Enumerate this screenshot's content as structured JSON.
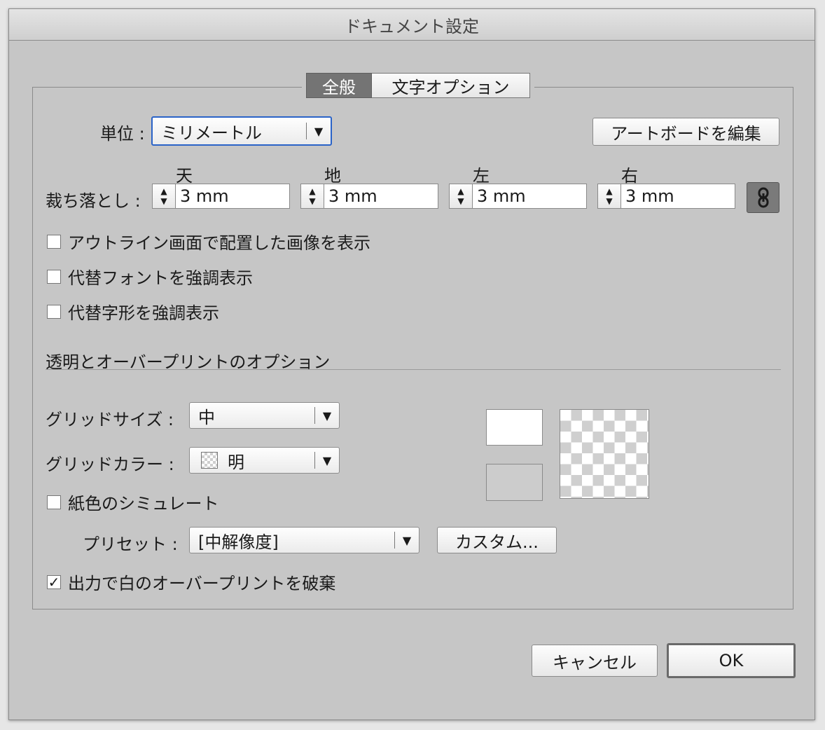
{
  "window": {
    "title": "ドキュメント設定"
  },
  "tabs": [
    {
      "label": "全般",
      "active": true
    },
    {
      "label": "文字オプション",
      "active": false
    }
  ],
  "units": {
    "label": "単位 :",
    "value": "ミリメートル"
  },
  "artboard_button": "アートボードを編集",
  "bleed": {
    "label": "裁ち落とし :",
    "fields": [
      {
        "header": "天",
        "value": "3 mm"
      },
      {
        "header": "地",
        "value": "3 mm"
      },
      {
        "header": "左",
        "value": "3 mm"
      },
      {
        "header": "右",
        "value": "3 mm"
      }
    ],
    "link_icon": "chain-link-icon"
  },
  "options": [
    {
      "label": "アウトライン画面で配置した画像を表示",
      "checked": false
    },
    {
      "label": "代替フォントを強調表示",
      "checked": false
    },
    {
      "label": "代替字形を強調表示",
      "checked": false
    }
  ],
  "transparency": {
    "section_title": "透明とオーバープリントのオプション",
    "grid_size": {
      "label": "グリッドサイズ :",
      "value": "中"
    },
    "grid_color": {
      "label": "グリッドカラー :",
      "value": "明",
      "swatch_icon": "checkerboard-swatch-icon"
    },
    "paper_sim": {
      "label": "紙色のシミュレート",
      "checked": false
    },
    "preset": {
      "label": "プリセット :",
      "value": "[中解像度]"
    },
    "custom_button": "カスタム...",
    "discard_white": {
      "label": "出力で白のオーバープリントを破棄",
      "checked": true
    },
    "swatch_top_color": "#ffffff",
    "swatch_bottom_color": "#cccccc"
  },
  "footer": {
    "cancel": "キャンセル",
    "ok": "OK"
  },
  "colors": {
    "dialog_bg": "#c6c6c6",
    "active_tab": "#747474",
    "focus_ring": "#2a63c8"
  }
}
